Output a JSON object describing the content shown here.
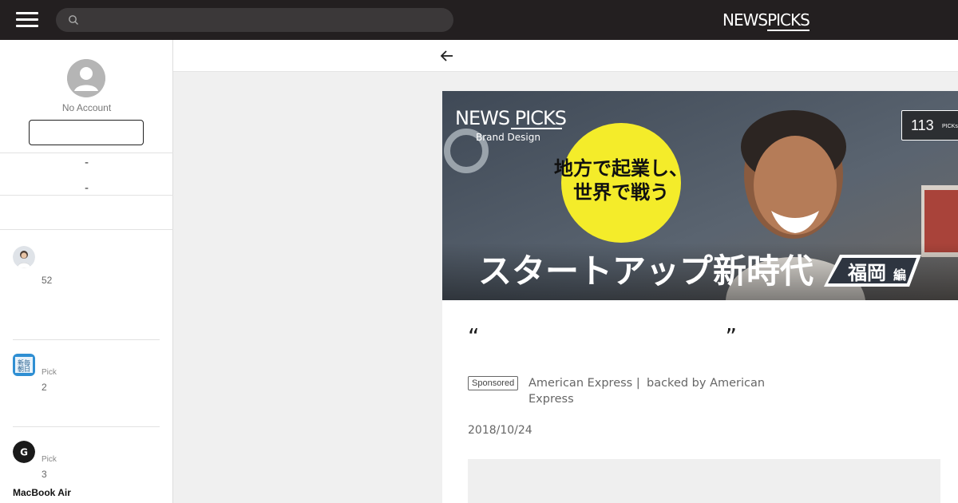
{
  "header": {
    "brand_news": "NEWS",
    "brand_picks": "PICKS",
    "search": {
      "placeholder": "",
      "value": ""
    }
  },
  "sidebar": {
    "account_label": "No Account",
    "login_button_label": "",
    "dash_1": "-",
    "dash_2": "-",
    "picks": [
      {
        "label": "",
        "count": "52"
      },
      {
        "label": "Pick",
        "count": "2",
        "avatar_text": "新毎\n朝日"
      },
      {
        "label": "Pick",
        "count": "3",
        "avatar_text": "G"
      }
    ],
    "product_title": "MacBook Air"
  },
  "article": {
    "hero": {
      "logo_news": "NEWS PICKS",
      "logo_sub": "Brand Design",
      "circle_line1": "地方で起業し、",
      "circle_line2": "世界で戦う",
      "banner_main": "スタートアップ新時代",
      "banner_tag": "福岡",
      "banner_tag_suffix": "編"
    },
    "picks_count": "113",
    "picks_label": "PICKs",
    "title": "“　　　　　　　　　　　”　　　　　　　　　　　　　　　",
    "sponsored_label": "Sponsored",
    "sponsor_name": "American Express |",
    "backed_by": "backed by American",
    "sponsor_name_2": "Express",
    "date": "2018/10/24"
  },
  "colors": {
    "header_bg": "#231f20",
    "search_bg": "#3b3839",
    "sidebar_bg": "#ffffff",
    "page_bg": "#f0f0f0",
    "hero_yellow": "#f4ec2a"
  }
}
